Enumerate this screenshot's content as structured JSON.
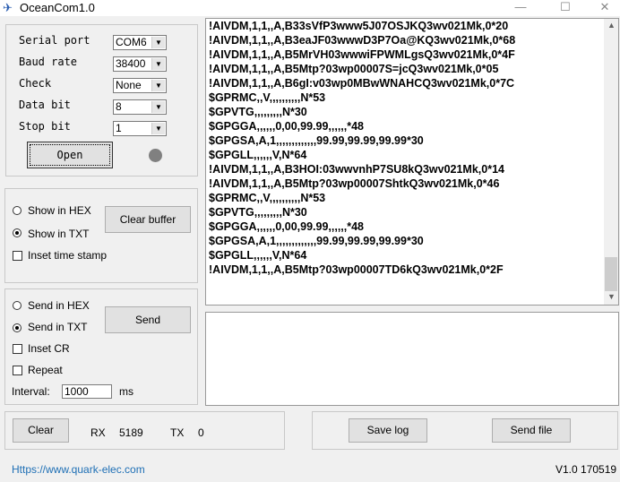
{
  "window": {
    "title": "OceanCom1.0",
    "minimize": "—",
    "maximize": "☐",
    "close": "✕"
  },
  "serial": {
    "port_label": "Serial port",
    "port": "COM6",
    "baud_label": "Baud rate",
    "baud": "38400",
    "check_label": "Check",
    "check": "None",
    "data_label": "Data bit",
    "data": "8",
    "stop_label": "Stop bit",
    "stop": "1",
    "open": "Open",
    "status_color": "#808080"
  },
  "display": {
    "hex": "Show in HEX",
    "txt": "Show in TXT",
    "timestamp": "Inset time stamp",
    "clear_buffer": "Clear buffer"
  },
  "send": {
    "hex": "Send in HEX",
    "txt": "Send in TXT",
    "cr": "Inset CR",
    "repeat": "Repeat",
    "interval_label": "Interval:",
    "interval": "1000",
    "ms": "ms",
    "send": "Send"
  },
  "log": [
    "!AIVDM,1,1,,A,B33sVfP3www5J07OSJKQ3wv021Mk,0*20",
    "!AIVDM,1,1,,A,B3eaJF03wwwD3P7Oa@KQ3wv021Mk,0*68",
    "!AIVDM,1,1,,A,B5MrVH03wwwiFPWMLgsQ3wv021Mk,0*4F",
    "!AIVDM,1,1,,A,B5Mtp?03wp00007S=jcQ3wv021Mk,0*05",
    "!AIVDM,1,1,,A,B6gI:v03wp0MBwWNAHCQ3wv021Mk,0*7C",
    "$GPRMC,,V,,,,,,,,,,N*53",
    "$GPVTG,,,,,,,,,N*30",
    "$GPGGA,,,,,,0,00,99.99,,,,,,*48",
    "$GPGSA,A,1,,,,,,,,,,,,,99.99,99.99,99.99*30",
    "$GPGLL,,,,,,V,N*64",
    "!AIVDM,1,1,,A,B3HOI:03wwvnhP7SU8kQ3wv021Mk,0*14",
    "!AIVDM,1,1,,A,B5Mtp?03wp00007ShtkQ3wv021Mk,0*46",
    "$GPRMC,,V,,,,,,,,,,N*53",
    "$GPVTG,,,,,,,,,N*30",
    "$GPGGA,,,,,,0,00,99.99,,,,,,*48",
    "$GPGSA,A,1,,,,,,,,,,,,,99.99,99.99,99.99*30",
    "$GPGLL,,,,,,V,N*64",
    "!AIVDM,1,1,,A,B5Mtp?03wp00007TD6kQ3wv021Mk,0*2F"
  ],
  "bottom": {
    "clear": "Clear",
    "rx_label": "RX",
    "rx": "5189",
    "tx_label": "TX",
    "tx": "0",
    "save_log": "Save log",
    "send_file": "Send file"
  },
  "footer": {
    "link": "Https://www.quark-elec.com",
    "version": "V1.0 170519",
    "link_color": "#1e6fb5"
  }
}
